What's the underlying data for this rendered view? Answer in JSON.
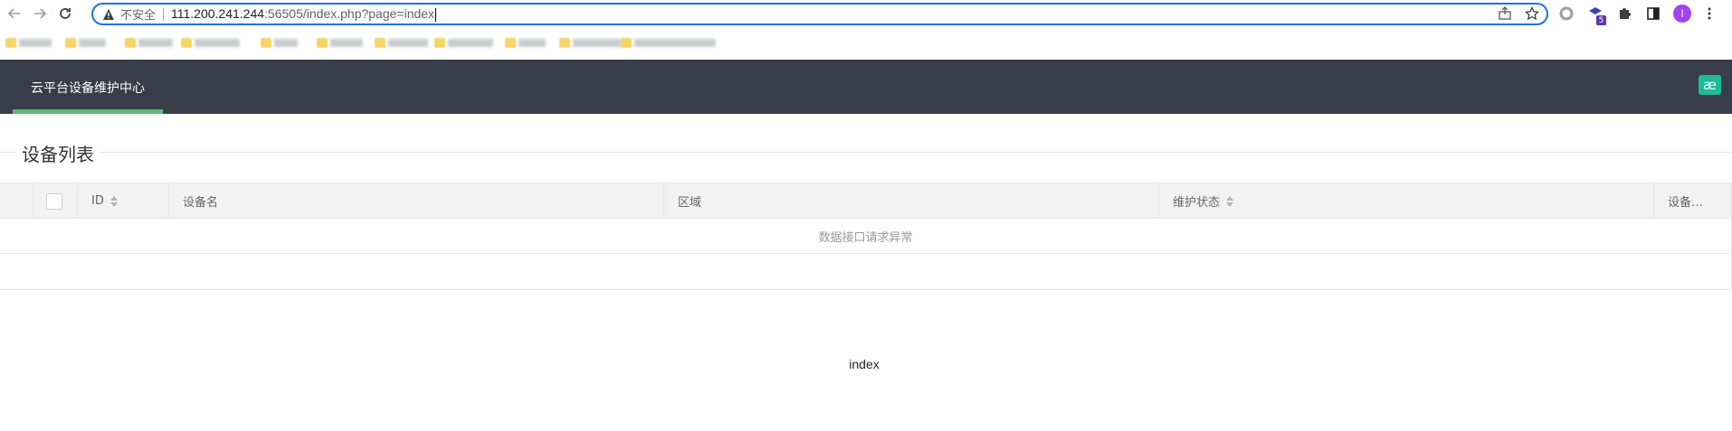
{
  "browser": {
    "security_label": "不安全",
    "url_host": "111.200.241.244",
    "url_rest": ":56505/index.php?page=index",
    "extension_badge": "5",
    "profile_initial": "I"
  },
  "app": {
    "title": "云平台设备维护中心",
    "logo_glyph": "æ",
    "accent_color": "#5fb878",
    "header_color": "#393d49"
  },
  "section": {
    "legend": "设备列表"
  },
  "table": {
    "columns": [
      "ID",
      "设备名",
      "区域",
      "维护状态",
      "设备…"
    ],
    "message": "数据接口请求异常"
  },
  "footer": {
    "text": "index"
  }
}
